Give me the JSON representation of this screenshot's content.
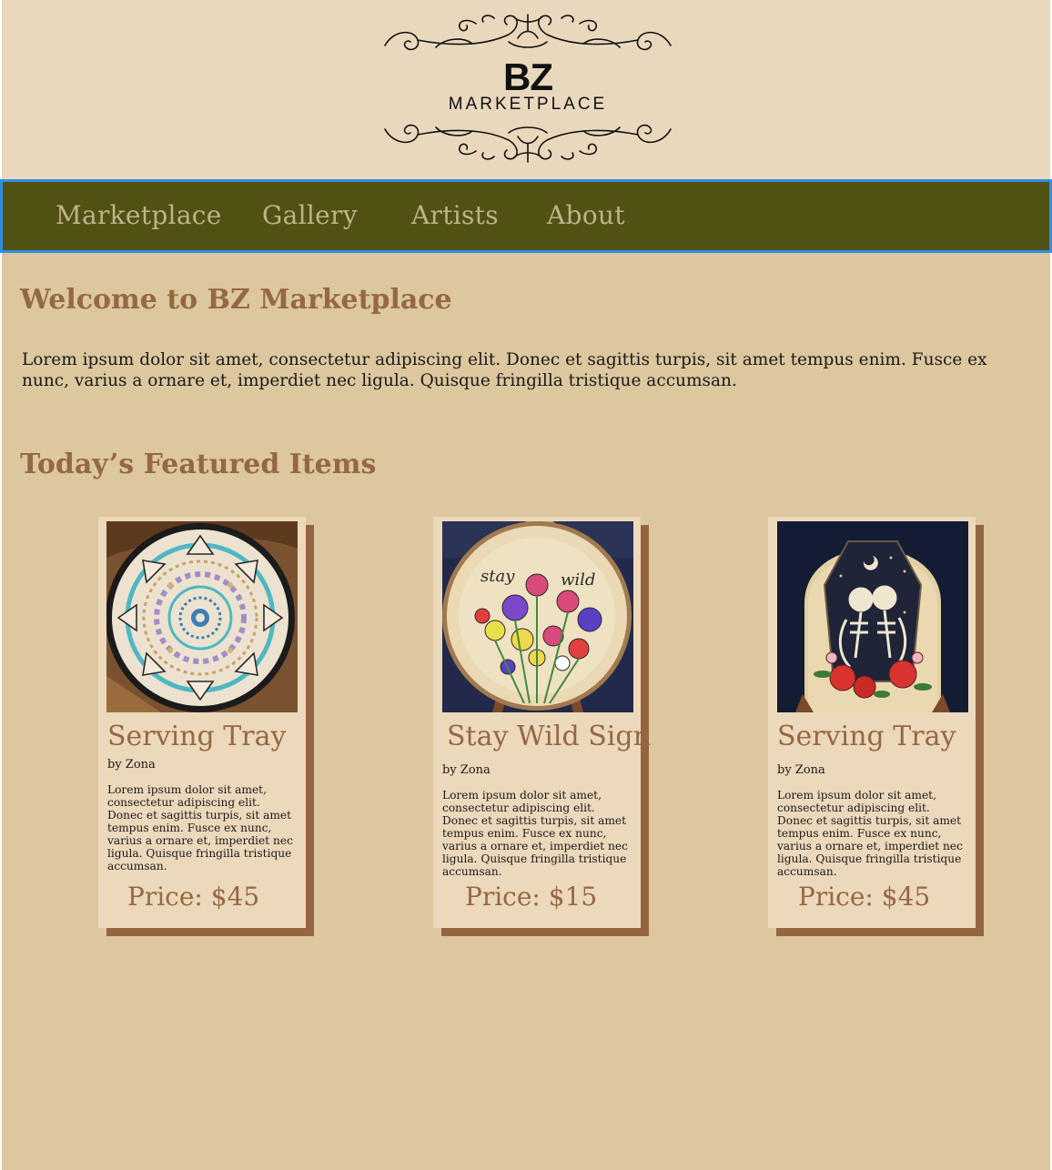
{
  "header": {
    "logo_main": "BZ",
    "logo_sub": "MARKETPLACE"
  },
  "nav": {
    "items": [
      {
        "label": "Marketplace"
      },
      {
        "label": "Gallery"
      },
      {
        "label": "Artists"
      },
      {
        "label": "About"
      }
    ]
  },
  "main": {
    "welcome_title": "Welcome to BZ Marketplace",
    "intro": "Lorem ipsum dolor sit amet, consectetur adipiscing elit. Donec et sagittis turpis, sit amet tempus enim. Fusce ex nunc, varius a ornare et, imperdiet nec ligula. Quisque fringilla tristique accumsan.",
    "featured_title": "Today’s Featured Items"
  },
  "items": [
    {
      "title": "Serving Tray",
      "artist": "by Zona",
      "description": "Lorem ipsum dolor sit amet, consectetur adipiscing elit. Donec et sagittis turpis, sit amet tempus enim. Fusce ex nunc, varius a ornare et, imperdiet nec ligula. Quisque fringilla tristique accumsan.",
      "price": "Price: $45",
      "image": "mandala-seashell-tray-image"
    },
    {
      "title": "Stay Wild Sign",
      "artist": "by Zona",
      "description": "Lorem ipsum dolor sit amet, consectetur adipiscing elit. Donec et sagittis turpis, sit amet tempus enim. Fusce ex nunc, varius a ornare et, imperdiet nec ligula. Quisque fringilla tristique accumsan.",
      "price": "Price: $15",
      "image": "stay-wild-floral-sign-image",
      "image_text_left": "stay",
      "image_text_right": "wild"
    },
    {
      "title": "Serving Tray",
      "artist": "by Zona",
      "description": "Lorem ipsum dolor sit amet, consectetur adipiscing elit. Donec et sagittis turpis, sit amet tempus enim. Fusce ex nunc, varius a ornare et, imperdiet nec ligula. Quisque fringilla tristique accumsan.",
      "price": "Price: $45",
      "image": "skeleton-lovers-coffin-tray-image"
    }
  ],
  "colors": {
    "page_bg": "#dcc79e",
    "header_bg": "#e9d8bd",
    "nav_bg": "#525114",
    "nav_text": "#bdb48a",
    "nav_focus_border": "#2d8fe6",
    "heading": "#956843",
    "card_bg": "#ecd8bb",
    "card_shadow": "#95653f"
  }
}
